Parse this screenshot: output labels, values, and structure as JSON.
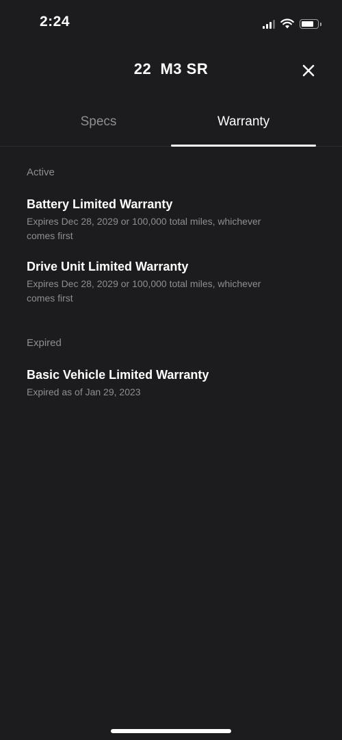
{
  "status_bar": {
    "time": "2:24",
    "battery_level": 0.8
  },
  "header": {
    "title": "22  M3 SR",
    "close_icon": "close-icon"
  },
  "tabs": [
    {
      "label": "Specs",
      "active": false
    },
    {
      "label": "Warranty",
      "active": true
    }
  ],
  "sections": {
    "active": {
      "label": "Active",
      "items": [
        {
          "title": "Battery Limited Warranty",
          "detail": "Expires Dec 28, 2029 or 100,000 total miles, whichever comes first"
        },
        {
          "title": "Drive Unit Limited Warranty",
          "detail": "Expires Dec 28, 2029 or 100,000 total miles, whichever comes first"
        }
      ]
    },
    "expired": {
      "label": "Expired",
      "items": [
        {
          "title": "Basic Vehicle Limited Warranty",
          "detail": "Expired as of Jan 29, 2023"
        }
      ]
    }
  },
  "colors": {
    "background": "#1c1c1e",
    "text_primary": "#ffffff",
    "text_secondary": "#8e8e93",
    "divider": "#2c2c2e"
  }
}
